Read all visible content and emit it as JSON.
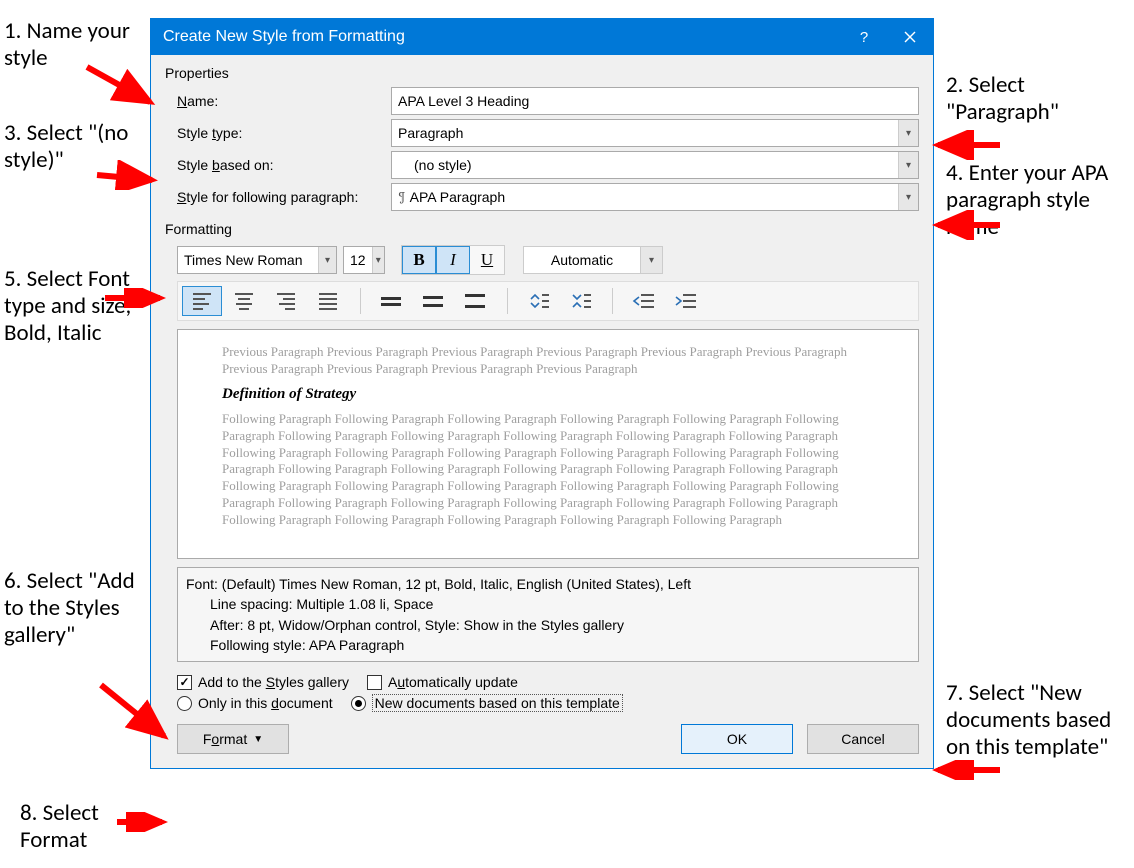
{
  "titlebar": {
    "title": "Create New Style from Formatting"
  },
  "sections": {
    "properties": "Properties",
    "formatting": "Formatting"
  },
  "labels": {
    "name": "Name:",
    "styletype": "Style type:",
    "basedon": "Style based on:",
    "following": "Style for following paragraph:"
  },
  "fields": {
    "name": "APA Level 3 Heading",
    "styletype": "Paragraph",
    "basedon": "(no style)",
    "following": "APA Paragraph"
  },
  "formatting": {
    "font": "Times New Roman",
    "size": "12",
    "color": "Automatic"
  },
  "preview": {
    "prev": "Previous Paragraph Previous Paragraph Previous Paragraph Previous Paragraph Previous Paragraph Previous Paragraph Previous Paragraph Previous Paragraph Previous Paragraph Previous Paragraph",
    "heading": "Definition of Strategy",
    "follow": "Following Paragraph Following Paragraph Following Paragraph Following Paragraph Following Paragraph Following Paragraph Following Paragraph Following Paragraph Following Paragraph Following Paragraph Following Paragraph Following Paragraph Following Paragraph Following Paragraph Following Paragraph Following Paragraph Following Paragraph Following Paragraph Following Paragraph Following Paragraph Following Paragraph Following Paragraph Following Paragraph Following Paragraph Following Paragraph Following Paragraph Following Paragraph Following Paragraph Following Paragraph Following Paragraph Following Paragraph Following Paragraph Following Paragraph Following Paragraph Following Paragraph Following Paragraph Following Paragraph Following Paragraph"
  },
  "description": {
    "l1": "Font: (Default) Times New Roman, 12 pt, Bold, Italic, English (United States), Left",
    "l2": "Line spacing:  Multiple 1.08 li, Space",
    "l3": "After:  8 pt, Widow/Orphan control, Style: Show in the Styles gallery",
    "l4": "Following style: APA Paragraph"
  },
  "checks": {
    "addgallery": "Add to the Styles gallery",
    "autoupdate": "Automatically update",
    "onlydoc": "Only in this document",
    "template": "New documents based on this template"
  },
  "buttons": {
    "format": "Format",
    "ok": "OK",
    "cancel": "Cancel"
  },
  "annotations": {
    "a1": "1. Name your style",
    "a2": "2. Select \"Paragraph\"",
    "a3": "3. Select \"(no style)\"",
    "a4": "4. Enter your APA paragraph style name",
    "a5": "5. Select Font type and size, Bold, Italic",
    "a6": "6. Select \"Add to the Styles gallery\"",
    "a7": "7. Select \"New documents based on this template\"",
    "a8": "8. Select Format"
  }
}
